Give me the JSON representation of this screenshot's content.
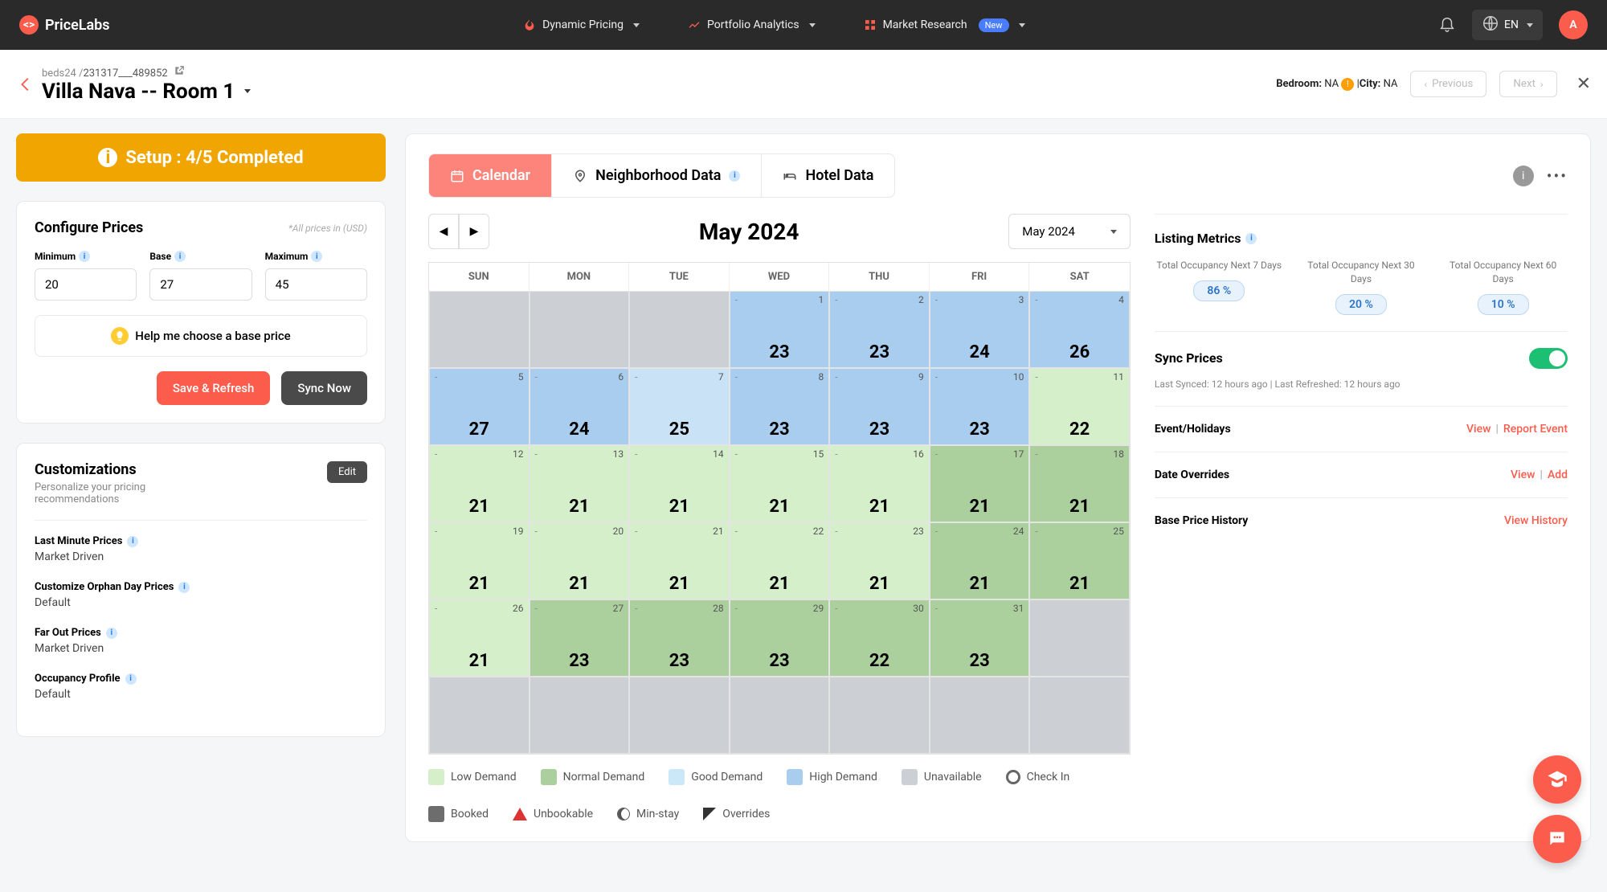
{
  "brand": "PriceLabs",
  "nav": {
    "dynamic": "Dynamic Pricing",
    "portfolio": "Portfolio Analytics",
    "market": "Market Research",
    "new": "New",
    "lang": "EN",
    "avatar": "A"
  },
  "sub": {
    "source": "beds24 /",
    "id": "231317___489852",
    "title": "Villa Nava -- Room 1",
    "bedroom_label": "Bedroom:",
    "bedroom_val": "NA",
    "city_label": "City:",
    "city_val": "NA",
    "prev": "Previous",
    "next": "Next"
  },
  "setup": "Setup : 4/5 Completed",
  "config": {
    "title": "Configure Prices",
    "currency_note": "*All prices in (USD)",
    "min_label": "Minimum",
    "min_val": "20",
    "base_label": "Base",
    "base_val": "27",
    "max_label": "Maximum",
    "max_val": "45",
    "help": "Help me choose a base price",
    "save": "Save & Refresh",
    "sync": "Sync Now"
  },
  "custom": {
    "title": "Customizations",
    "sub": "Personalize your pricing recommendations",
    "edit": "Edit",
    "items": [
      {
        "label": "Last Minute Prices",
        "value": "Market Driven"
      },
      {
        "label": "Customize Orphan Day Prices",
        "value": "Default"
      },
      {
        "label": "Far Out Prices",
        "value": "Market Driven"
      },
      {
        "label": "Occupancy Profile",
        "value": "Default"
      }
    ]
  },
  "tabs": {
    "calendar": "Calendar",
    "neighborhood": "Neighborhood Data",
    "hotel": "Hotel Data"
  },
  "cal": {
    "month": "May 2024",
    "select": "May 2024",
    "dow": [
      "SUN",
      "MON",
      "TUE",
      "WED",
      "THU",
      "FRI",
      "SAT"
    ],
    "cells": [
      {
        "cls": "c-unavail"
      },
      {
        "cls": "c-unavail"
      },
      {
        "cls": "c-unavail"
      },
      {
        "d": "1",
        "p": "23",
        "cls": "c-high"
      },
      {
        "d": "2",
        "p": "23",
        "cls": "c-high"
      },
      {
        "d": "3",
        "p": "24",
        "cls": "c-high"
      },
      {
        "d": "4",
        "p": "26",
        "cls": "c-high"
      },
      {
        "d": "5",
        "p": "27",
        "cls": "c-high"
      },
      {
        "d": "6",
        "p": "24",
        "cls": "c-high"
      },
      {
        "d": "7",
        "p": "25",
        "cls": "c-highl"
      },
      {
        "d": "8",
        "p": "23",
        "cls": "c-high"
      },
      {
        "d": "9",
        "p": "23",
        "cls": "c-high"
      },
      {
        "d": "10",
        "p": "23",
        "cls": "c-high"
      },
      {
        "d": "11",
        "p": "22",
        "cls": "c-low"
      },
      {
        "d": "12",
        "p": "21",
        "cls": "c-low"
      },
      {
        "d": "13",
        "p": "21",
        "cls": "c-low"
      },
      {
        "d": "14",
        "p": "21",
        "cls": "c-low"
      },
      {
        "d": "15",
        "p": "21",
        "cls": "c-low"
      },
      {
        "d": "16",
        "p": "21",
        "cls": "c-low"
      },
      {
        "d": "17",
        "p": "21",
        "cls": "c-normal"
      },
      {
        "d": "18",
        "p": "21",
        "cls": "c-normal"
      },
      {
        "d": "19",
        "p": "21",
        "cls": "c-low"
      },
      {
        "d": "20",
        "p": "21",
        "cls": "c-low"
      },
      {
        "d": "21",
        "p": "21",
        "cls": "c-low"
      },
      {
        "d": "22",
        "p": "21",
        "cls": "c-low"
      },
      {
        "d": "23",
        "p": "21",
        "cls": "c-low"
      },
      {
        "d": "24",
        "p": "21",
        "cls": "c-normal"
      },
      {
        "d": "25",
        "p": "21",
        "cls": "c-normal"
      },
      {
        "d": "26",
        "p": "21",
        "cls": "c-low"
      },
      {
        "d": "27",
        "p": "23",
        "cls": "c-normal"
      },
      {
        "d": "28",
        "p": "23",
        "cls": "c-normal"
      },
      {
        "d": "29",
        "p": "23",
        "cls": "c-normal"
      },
      {
        "d": "30",
        "p": "22",
        "cls": "c-normal"
      },
      {
        "d": "31",
        "p": "23",
        "cls": "c-normal"
      },
      {
        "cls": "c-unavail"
      },
      {
        "cls": "c-unavail"
      },
      {
        "cls": "c-unavail"
      },
      {
        "cls": "c-unavail"
      },
      {
        "cls": "c-unavail"
      },
      {
        "cls": "c-unavail"
      },
      {
        "cls": "c-unavail"
      },
      {
        "cls": "c-unavail"
      }
    ]
  },
  "legend": {
    "low": "Low Demand",
    "normal": "Normal Demand",
    "good": "Good Demand",
    "high": "High Demand",
    "unavail": "Unavailable",
    "checkin": "Check In",
    "booked": "Booked",
    "unbook": "Unbookable",
    "minstay": "Min-stay",
    "over": "Overrides"
  },
  "metrics": {
    "title": "Listing Metrics",
    "occ7_l": "Total Occupancy Next 7 Days",
    "occ7_v": "86 %",
    "occ30_l": "Total Occupancy Next 30 Days",
    "occ30_v": "20 %",
    "occ60_l": "Total Occupancy Next 60 Days",
    "occ60_v": "10 %",
    "sync": "Sync Prices",
    "sync_sub": "Last Synced: 12 hours ago | Last Refreshed: 12 hours ago",
    "events": "Event/Holidays",
    "view": "View",
    "report": "Report Event",
    "dateov": "Date Overrides",
    "add": "Add",
    "bph": "Base Price History",
    "vh": "View History"
  }
}
